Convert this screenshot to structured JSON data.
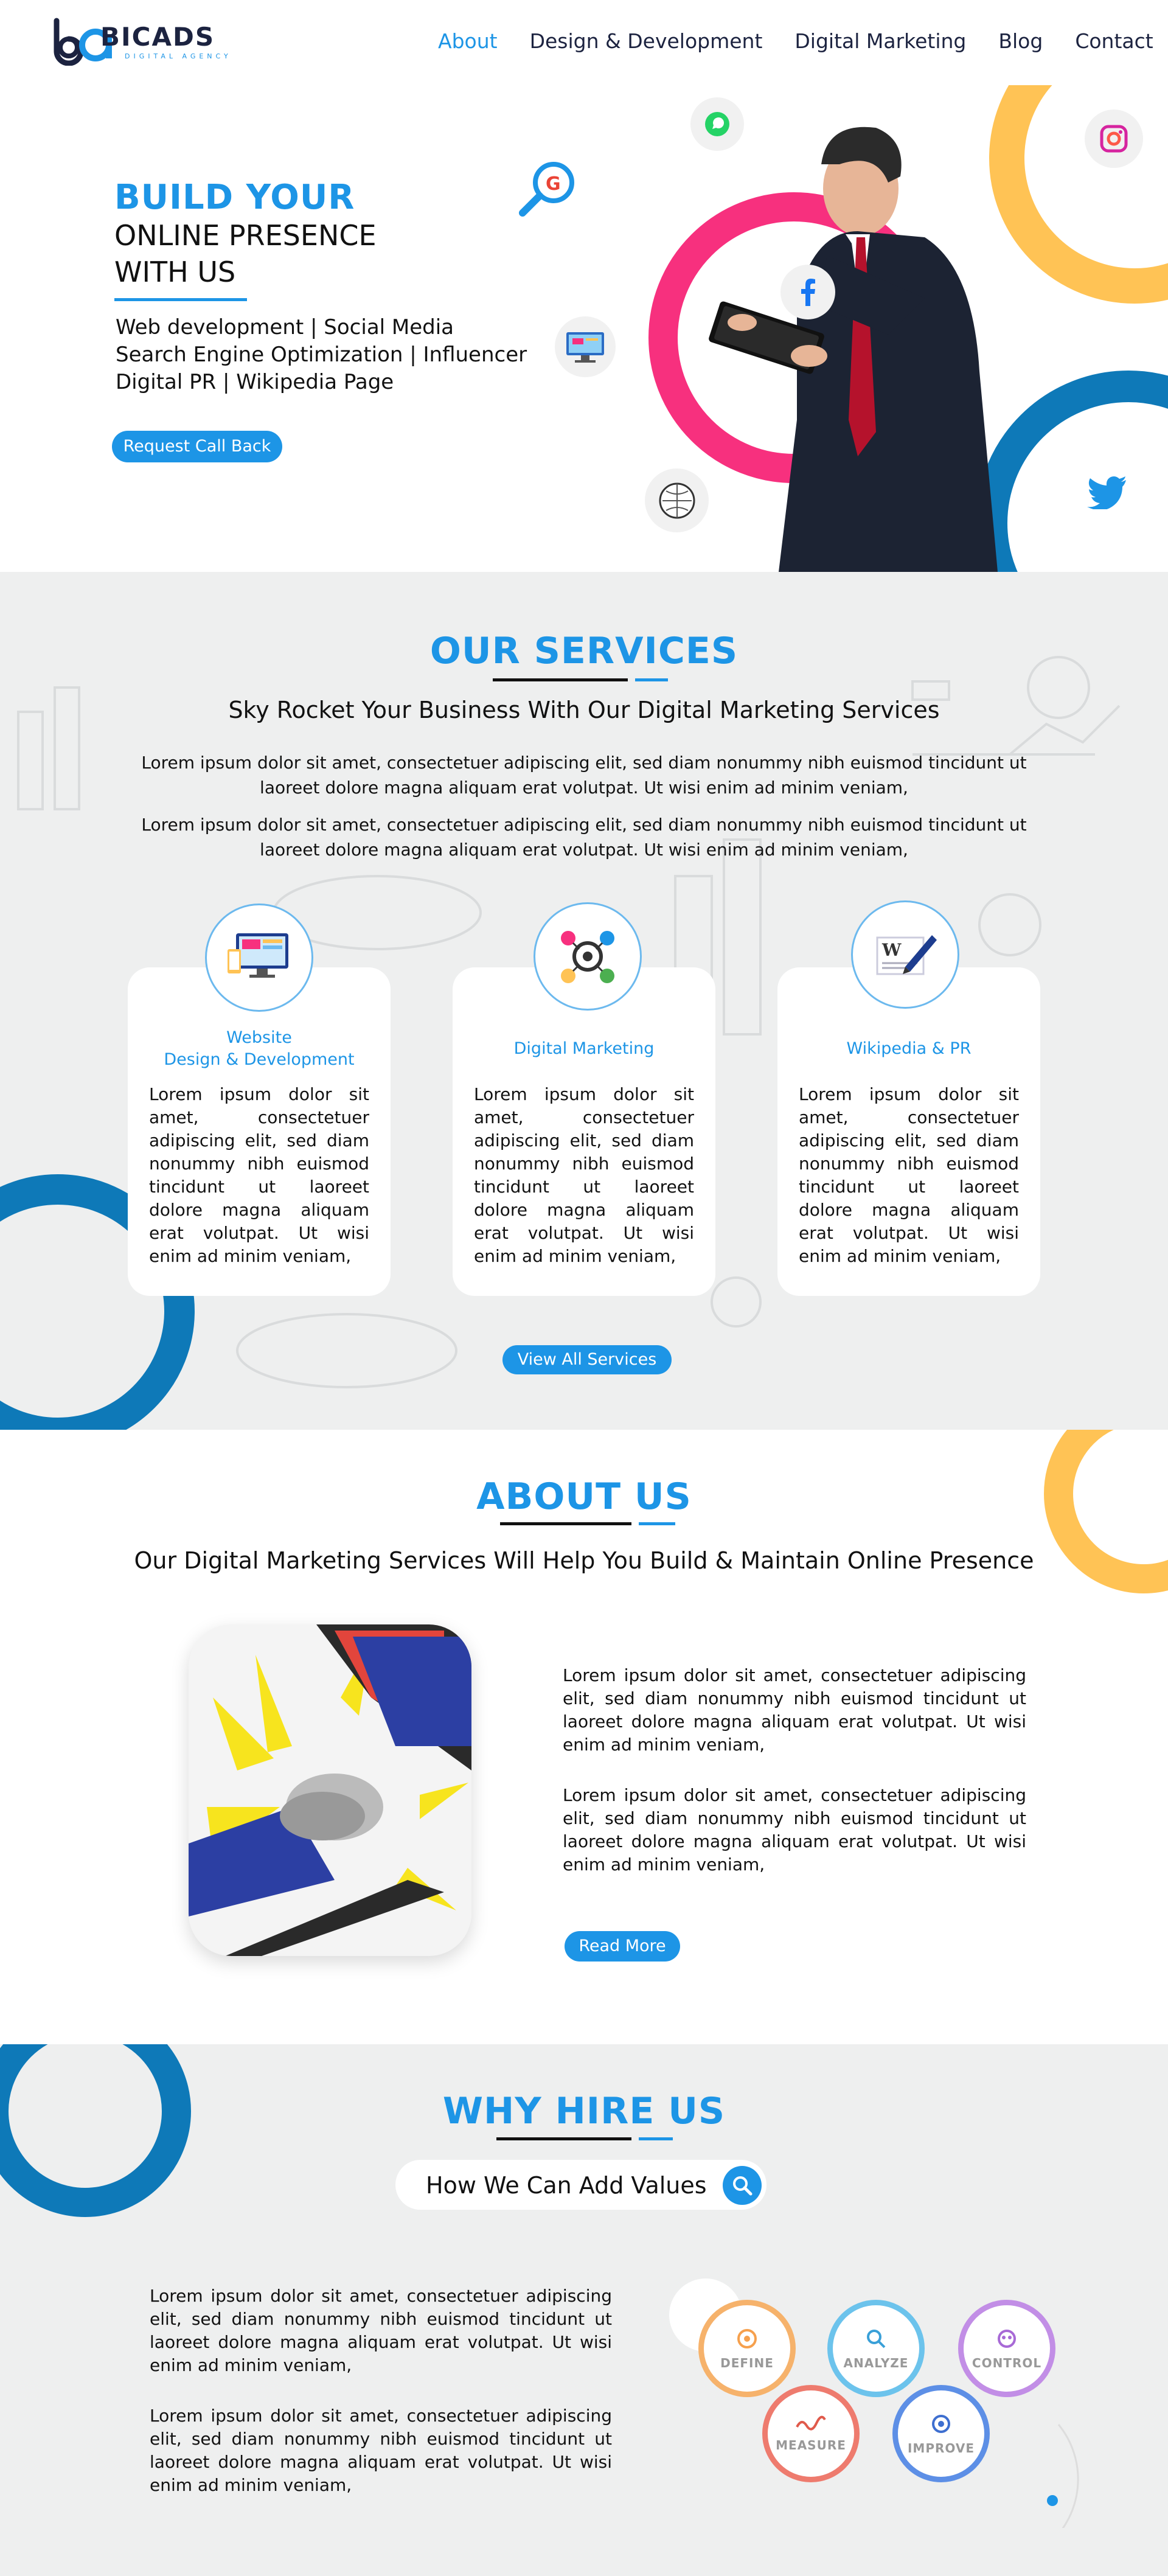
{
  "brand": {
    "name": "BICADS",
    "tagline": "DIGITAL AGENCY",
    "mark": "ba",
    "colors": {
      "primary": "#1d95e6",
      "navy": "#1c2340",
      "pink": "#f7307e",
      "yellow": "#ffc355",
      "deep_blue": "#0e79b8"
    }
  },
  "nav": {
    "items": [
      "About",
      "Design & Development",
      "Digital Marketing",
      "Blog",
      "Contact"
    ],
    "active": "About"
  },
  "hero": {
    "title_line1": "BUILD YOUR",
    "title_line2": "ONLINE PRESENCE",
    "title_line3": "WITH US",
    "lines": [
      "Web development | Social Media",
      "Search Engine Optimization | Influencer",
      "Digital PR | Wikipedia Page"
    ],
    "cta": "Request Call Back",
    "icons": [
      "whatsapp-icon",
      "google-search-icon",
      "facebook-icon",
      "computer-icon",
      "wikipedia-icon",
      "instagram-icon",
      "twitter-icon"
    ]
  },
  "services": {
    "title": "OUR SERVICES",
    "subtitle": "Sky Rocket Your Business With Our Digital Marketing Services",
    "paragraphs": [
      "Lorem ipsum dolor sit amet, consectetuer adipiscing elit, sed diam nonummy nibh euismod tincidunt ut laoreet dolore magna aliquam erat volutpat. Ut wisi enim ad minim veniam,",
      "Lorem ipsum dolor sit amet, consectetuer adipiscing elit, sed diam nonummy nibh euismod tincidunt ut laoreet dolore magna aliquam erat volutpat. Ut wisi enim ad minim veniam,"
    ],
    "cards": [
      {
        "title_line1": "Website",
        "title_line2": "Design & Development",
        "body": "Lorem ipsum dolor sit amet, consectetuer adipiscing elit, sed diam nonummy nibh euismod tincidunt ut laoreet dolore magna aliquam erat volutpat. Ut wisi enim ad minim veniam,"
      },
      {
        "title_line1": "Digital Marketing",
        "title_line2": "",
        "body": "Lorem ipsum dolor sit amet, consectetuer adipiscing elit, sed diam nonummy nibh euismod tincidunt ut laoreet dolore magna aliquam erat volutpat. Ut wisi enim ad minim veniam,"
      },
      {
        "title_line1": "Wikipedia & PR",
        "title_line2": "",
        "body": "Lorem ipsum dolor sit amet, consectetuer adipiscing elit, sed diam nonummy nibh euismod tincidunt ut laoreet dolore magna aliquam erat volutpat. Ut wisi enim ad minim veniam,"
      }
    ],
    "cta": "View All Services"
  },
  "about": {
    "title": "ABOUT US",
    "subtitle": "Our Digital Marketing Services Will Help You Build & Maintain Online Presence",
    "paragraphs": [
      "Lorem ipsum dolor sit amet, consectetuer adipiscing elit, sed diam nonummy nibh euismod tincidunt ut laoreet dolore magna aliquam erat volutpat. Ut wisi enim ad minim veniam,",
      "Lorem ipsum dolor sit amet, consectetuer adipiscing elit, sed diam nonummy nibh euismod tincidunt ut laoreet dolore magna aliquam erat volutpat. Ut wisi enim ad minim veniam,"
    ],
    "cta": "Read More"
  },
  "why": {
    "title": "WHY HIRE US",
    "subtitle": "How We Can Add Values",
    "paragraphs": [
      "Lorem ipsum dolor sit amet, consectetuer adipiscing elit, sed diam nonummy nibh euismod tincidunt ut laoreet dolore magna aliquam erat volutpat. Ut wisi enim ad minim veniam,",
      "Lorem ipsum dolor sit amet, consectetuer adipiscing elit, sed diam nonummy nibh euismod tincidunt ut laoreet dolore magna aliquam erat volutpat. Ut wisi enim ad minim veniam,"
    ],
    "steps": [
      "DEFINE",
      "ANALYZE",
      "CONTROL",
      "MEASURE",
      "IMPROVE"
    ]
  }
}
